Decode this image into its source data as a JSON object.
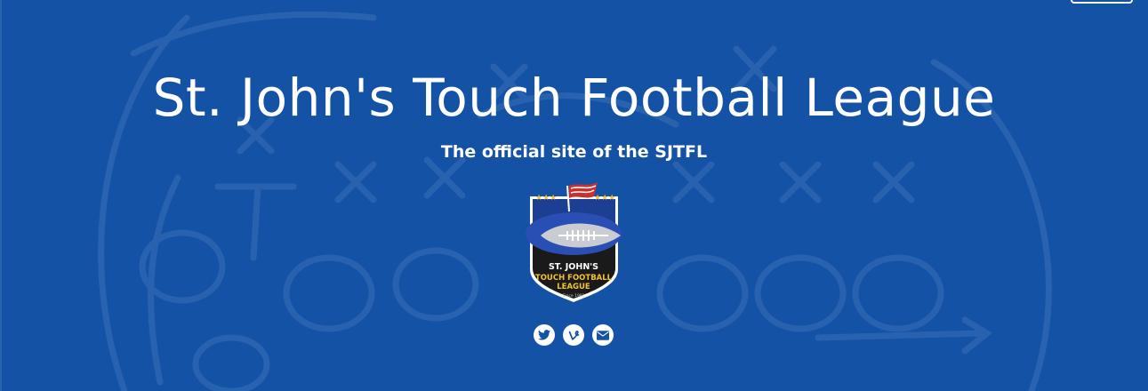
{
  "header": {
    "title": "St. John's Touch Football League",
    "subtitle": "The official site of the SJTFL"
  },
  "logo": {
    "line1": "ST. JOHN'S",
    "line2": "TOUCH FOOTBALL",
    "line3": "LEAGUE",
    "line4": "Since 1981",
    "stars_left": "★★★",
    "stars_right": "★★★"
  },
  "social": {
    "icons": [
      "twitter-icon",
      "vine-icon",
      "mail-icon"
    ]
  },
  "colors": {
    "background": "#1452a5",
    "text": "#ffffff",
    "logo_gold": "#f2c12e",
    "logo_dark": "#1a1a1a"
  }
}
